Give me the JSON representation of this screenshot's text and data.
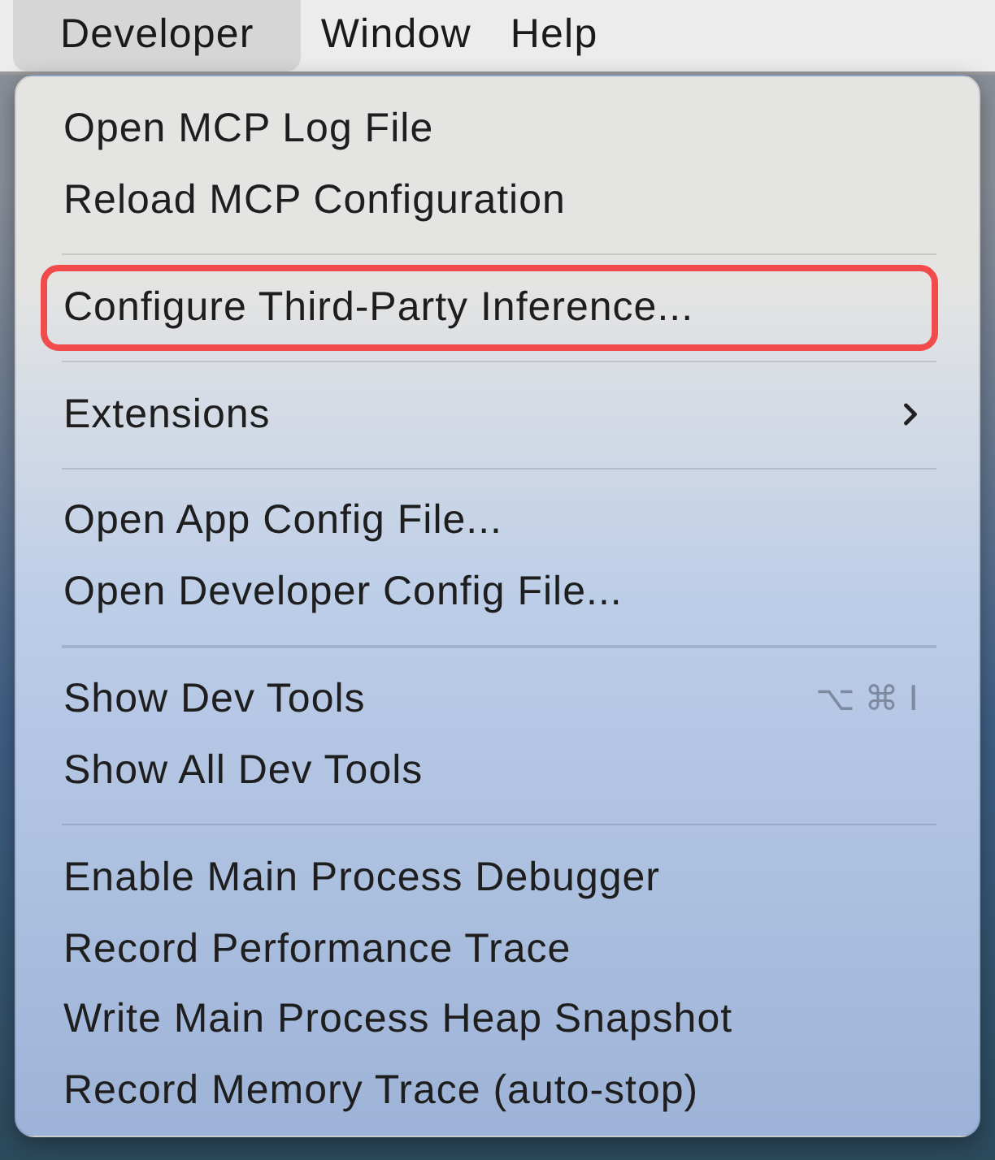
{
  "menu_bar": {
    "items": [
      {
        "label": "Developer",
        "selected": true
      },
      {
        "label": "Window",
        "selected": false
      },
      {
        "label": "Help",
        "selected": false
      }
    ]
  },
  "menu": {
    "sections": [
      {
        "items": [
          {
            "label": "Open MCP Log File",
            "kind": "action",
            "outlined": false
          },
          {
            "label": "Reload MCP Configuration",
            "kind": "action",
            "outlined": false
          }
        ]
      },
      {
        "items": [
          {
            "label": "Configure Third-Party Inference...",
            "kind": "action",
            "outlined": true
          }
        ]
      },
      {
        "items": [
          {
            "label": "Extensions",
            "kind": "submenu",
            "outlined": false
          }
        ]
      },
      {
        "items": [
          {
            "label": "Open App Config File...",
            "kind": "action",
            "outlined": false
          },
          {
            "label": "Open Developer Config File...",
            "kind": "action",
            "outlined": false
          }
        ]
      },
      {
        "items": [
          {
            "label": "Show Dev Tools",
            "kind": "action",
            "outlined": false,
            "shortcut": "⌥⌘I"
          },
          {
            "label": "Show All Dev Tools",
            "kind": "action",
            "outlined": false
          }
        ]
      },
      {
        "items": [
          {
            "label": "Enable Main Process Debugger",
            "kind": "action",
            "outlined": false
          },
          {
            "label": "Record Performance Trace",
            "kind": "action",
            "outlined": false
          },
          {
            "label": "Write Main Process Heap Snapshot",
            "kind": "action",
            "outlined": false
          },
          {
            "label": "Record Memory Trace (auto-stop)",
            "kind": "action",
            "outlined": false
          }
        ]
      }
    ]
  }
}
